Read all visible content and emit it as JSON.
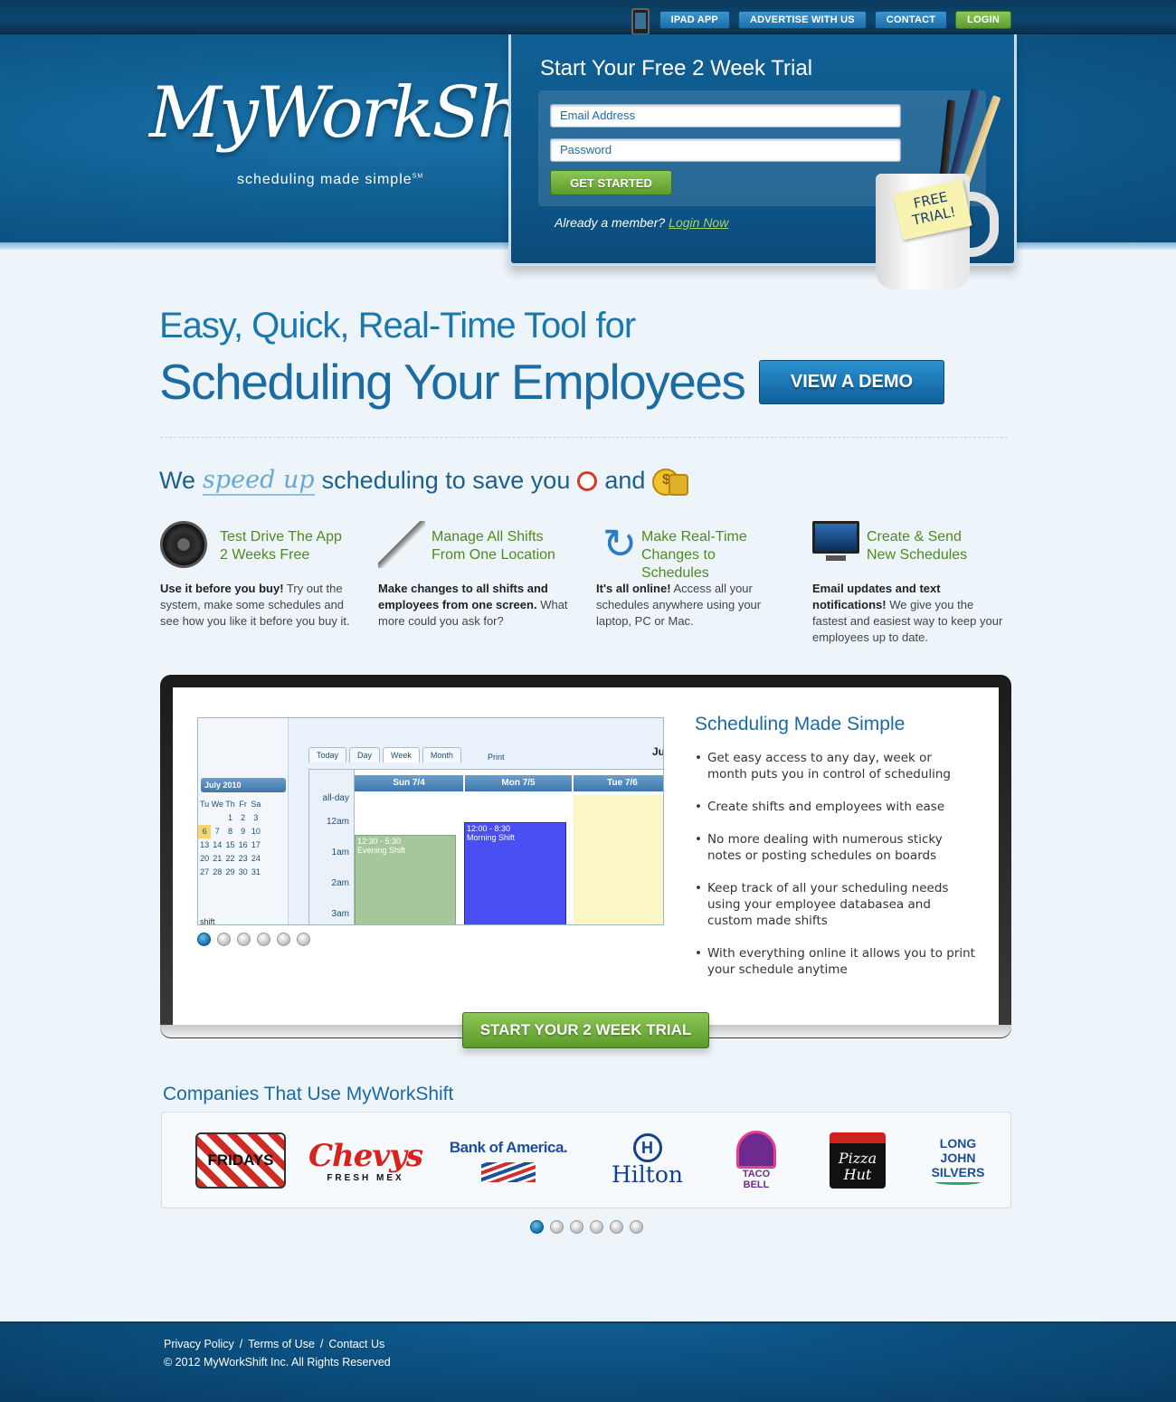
{
  "topnav": {
    "items": [
      "IPAD APP",
      "ADVERTISE WITH US",
      "CONTACT",
      "LOGIN"
    ]
  },
  "logo": {
    "script": "MyWorkShift",
    "tagline": "scheduling made simple",
    "mark": "SM"
  },
  "signup": {
    "title": "Start Your Free 2 Week Trial",
    "email_placeholder": "Email Address",
    "password_placeholder": "Password",
    "submit": "GET STARTED",
    "member_text": "Already a member?",
    "login_link": "Login Now",
    "note": "FREE TRIAL!"
  },
  "hero": {
    "line1": "Easy, Quick, Real-Time Tool for",
    "line2": "Scheduling Your Employees",
    "demo_button": "VIEW A DEMO"
  },
  "tagline": {
    "we": "We",
    "speed": "speed up",
    "rest": "scheduling to save you",
    "and": "and"
  },
  "features": [
    {
      "icon": "steering-wheel-icon",
      "title_1": "Test Drive The App",
      "title_2": "2 Weeks Free",
      "bold": "Use it before you buy!",
      "text": " Try out the system, make some schedules and see how you like it before you buy it."
    },
    {
      "icon": "pen-icon",
      "title_1": "Manage All Shifts",
      "title_2": "From One Location",
      "bold": "Make changes to all shifts and employees from one screen.",
      "text": " What more could you ask for?"
    },
    {
      "icon": "refresh-icon",
      "title_1": "Make Real-Time",
      "title_2": "Changes to Schedules",
      "bold": "It's all online!",
      "text": " Access all your schedules anywhere using your laptop, PC or Mac."
    },
    {
      "icon": "monitor-icon",
      "title_1": "Create & Send",
      "title_2": "New Schedules",
      "bold": "Email updates and text notifications!",
      "text": " We give you the fastest and easiest way to keep your employees up to date."
    }
  ],
  "app_preview": {
    "tabs": [
      "Today",
      "Day",
      "Week",
      "Month"
    ],
    "print": "Print",
    "month_label": "July 2010",
    "current": "Ju",
    "weekdays": [
      "Tu",
      "We",
      "Th",
      "Fr",
      "Sa"
    ],
    "days": [
      [
        "",
        "",
        "1",
        "2",
        "3"
      ],
      [
        "6",
        "7",
        "8",
        "9",
        "10"
      ],
      [
        "13",
        "14",
        "15",
        "16",
        "17"
      ],
      [
        "20",
        "21",
        "22",
        "23",
        "24"
      ],
      [
        "27",
        "28",
        "29",
        "30",
        "31"
      ]
    ],
    "shift_label": "shift",
    "columns": [
      "Sun 7/4",
      "Mon 7/5",
      "Tue 7/6"
    ],
    "times": [
      "all-day",
      "12am",
      "1am",
      "2am",
      "3am"
    ],
    "events": [
      {
        "time": "12:30 - 5:30",
        "name": "Evening Shift"
      },
      {
        "time": "12:00 - 8:30",
        "name": "Morning Shift"
      }
    ]
  },
  "showcase": {
    "title": "Scheduling Made Simple",
    "bullets": [
      "Get easy access to any day, week or month puts you in control of scheduling",
      "Create shifts and employees with ease",
      "No more dealing with numerous sticky notes or posting schedules on boards",
      "Keep track of all your scheduling needs using your employee databasea and custom made shifts",
      "With everything online it allows you to print your schedule anytime"
    ],
    "trial_button": "START YOUR 2 WEEK TRIAL",
    "slide_count": 6,
    "active_slide": 1
  },
  "companies": {
    "title": "Companies That Use MyWorkShift",
    "brands": {
      "fridays": "FRIDAYS",
      "chevys": "Chevys",
      "chevys_sub": "FRESH MEX",
      "boa": "Bank of America.",
      "hilton_mark": "H",
      "hilton": "Hilton",
      "taco_1": "TACO",
      "taco_2": "BELL",
      "pizza": "Pizza Hut",
      "ljs_1": "LONG",
      "ljs_2": "JOHN",
      "ljs_3": "SILVERS"
    },
    "slide_count": 6,
    "active_slide": 1
  },
  "footer": {
    "links": [
      "Privacy Policy",
      "Terms of Use",
      "Contact Us"
    ],
    "separator": "/",
    "copyright": "© 2012 MyWorkShift Inc.  All Rights Reserved"
  }
}
